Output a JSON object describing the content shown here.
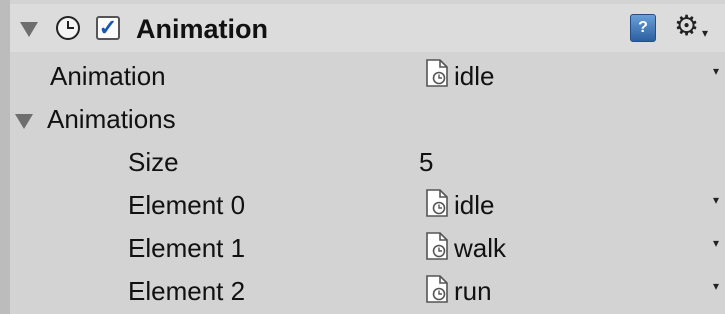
{
  "component": {
    "title": "Animation",
    "enabled_mark": "✓",
    "help_icon_glyph": "?",
    "settings_caret": "▾"
  },
  "fields": {
    "animation_label": "Animation",
    "animation_value": "idle",
    "animations_label": "Animations",
    "size_label": "Size",
    "size_value": "5",
    "elements": [
      {
        "label": "Element 0",
        "value": "idle"
      },
      {
        "label": "Element 1",
        "value": "walk"
      },
      {
        "label": "Element 2",
        "value": "run"
      }
    ]
  },
  "icons": {
    "foldout": "triangle-down-icon",
    "clock": "clock-icon",
    "help": "help-book-icon",
    "settings": "gear-icon",
    "asset": "animation-clip-icon",
    "dropdown": "dropdown-arrow-icon"
  }
}
